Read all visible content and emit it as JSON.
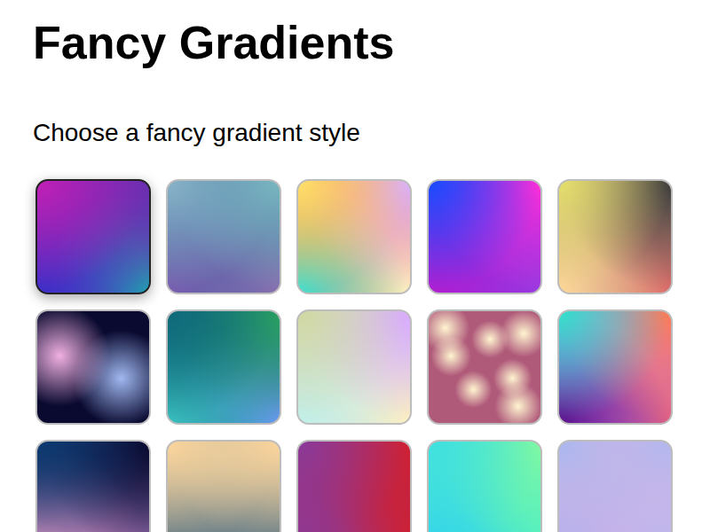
{
  "heading": "Fancy Gradients",
  "subtitle": "Choose a fancy gradient style",
  "swatches": [
    {
      "selected": true,
      "kind": "mesh",
      "colors": [
        "#c21fb5",
        "#6a2fb0",
        "#3b2fc9",
        "#1fa0b0",
        "#6a28b8"
      ]
    },
    {
      "selected": false,
      "kind": "mesh",
      "colors": [
        "#8ab4c8",
        "#7ab8c0",
        "#7a5cb0",
        "#8a70b0",
        "#3e6fa0"
      ]
    },
    {
      "selected": false,
      "kind": "mesh",
      "colors": [
        "#fde26a",
        "#d9b3ff",
        "#3fe0d0",
        "#fff3c4",
        "#ff7a45"
      ]
    },
    {
      "selected": false,
      "kind": "mesh",
      "colors": [
        "#1a4bff",
        "#ff2fd8",
        "#b11fd0",
        "#9a3ae0",
        "#8a2be2"
      ]
    },
    {
      "selected": false,
      "kind": "mesh",
      "colors": [
        "#e5e06a",
        "#3a3a3a",
        "#ffd79a",
        "#e06a6a",
        "#b89a80"
      ]
    },
    {
      "selected": false,
      "kind": "bokeh",
      "colors": [
        "#0a0a30",
        "#f0b0e0",
        "#a0b8f0"
      ]
    },
    {
      "selected": false,
      "kind": "mesh",
      "colors": [
        "#0f6b7a",
        "#2aa060",
        "#3ac0c0",
        "#6a9af0",
        "#157080"
      ]
    },
    {
      "selected": false,
      "kind": "mesh",
      "colors": [
        "#d0d8a0",
        "#d9a8ff",
        "#c0f0e8",
        "#fff0c0",
        "#d8e0e0"
      ]
    },
    {
      "selected": false,
      "kind": "bokeh",
      "colors": [
        "#b05a7a",
        "#fff5d0",
        "#fff5d0",
        "#fff5d0",
        "#fff5d0",
        "#fff5d0",
        "#fff5d0",
        "#fff5d0"
      ]
    },
    {
      "selected": false,
      "kind": "mesh",
      "colors": [
        "#30e0c8",
        "#ff7a50",
        "#5a108a",
        "#e06080",
        "#c080ff"
      ]
    },
    {
      "selected": false,
      "kind": "mesh",
      "colors": [
        "#0a3a70",
        "#0a0a30",
        "#f0a0d0",
        "#a070b0",
        "#202a60"
      ]
    },
    {
      "selected": false,
      "kind": "mesh",
      "colors": [
        "#fdd59a",
        "#fdd59a",
        "#4a6a80",
        "#4a6a80",
        "#b0b0a0"
      ]
    },
    {
      "selected": false,
      "kind": "mesh",
      "colors": [
        "#8a3a9a",
        "#d02030",
        "#8a3a9a",
        "#d02030",
        "#b02a60"
      ]
    },
    {
      "selected": false,
      "kind": "mesh",
      "colors": [
        "#40e0e0",
        "#80f8a0",
        "#30d0f0",
        "#50f0c0",
        "#4ae8d0"
      ]
    },
    {
      "selected": false,
      "kind": "mesh",
      "colors": [
        "#a8b8f0",
        "#b0b8f0",
        "#b0b0f0",
        "#b8b8f0",
        "#f4b0d8"
      ]
    }
  ]
}
